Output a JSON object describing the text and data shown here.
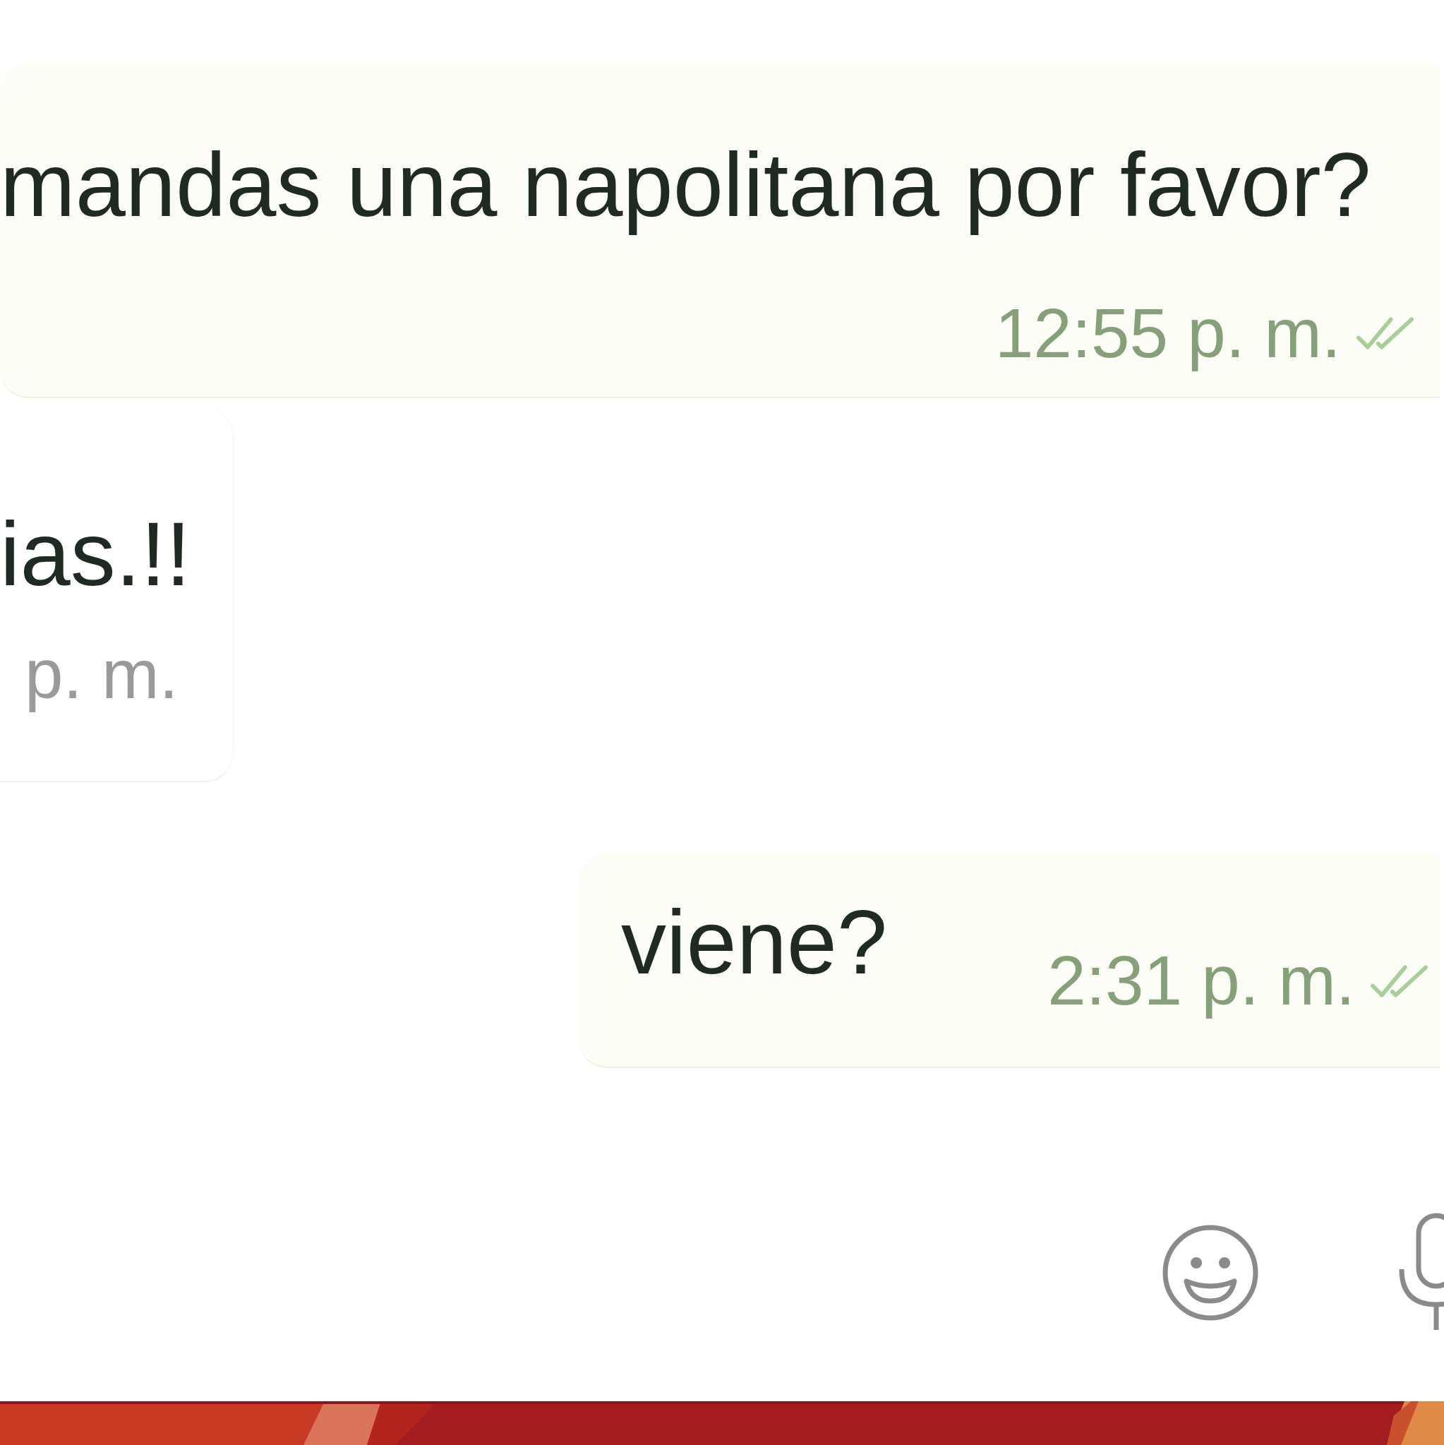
{
  "messages": [
    {
      "kind": "outgoing",
      "text": "mandas una napolitana por favor?",
      "time": "12:55 p. m."
    },
    {
      "kind": "incoming",
      "text": "ias.!!",
      "time": "p. m."
    },
    {
      "kind": "outgoing_inline",
      "text": "viene?",
      "time": "2:31 p. m."
    }
  ]
}
